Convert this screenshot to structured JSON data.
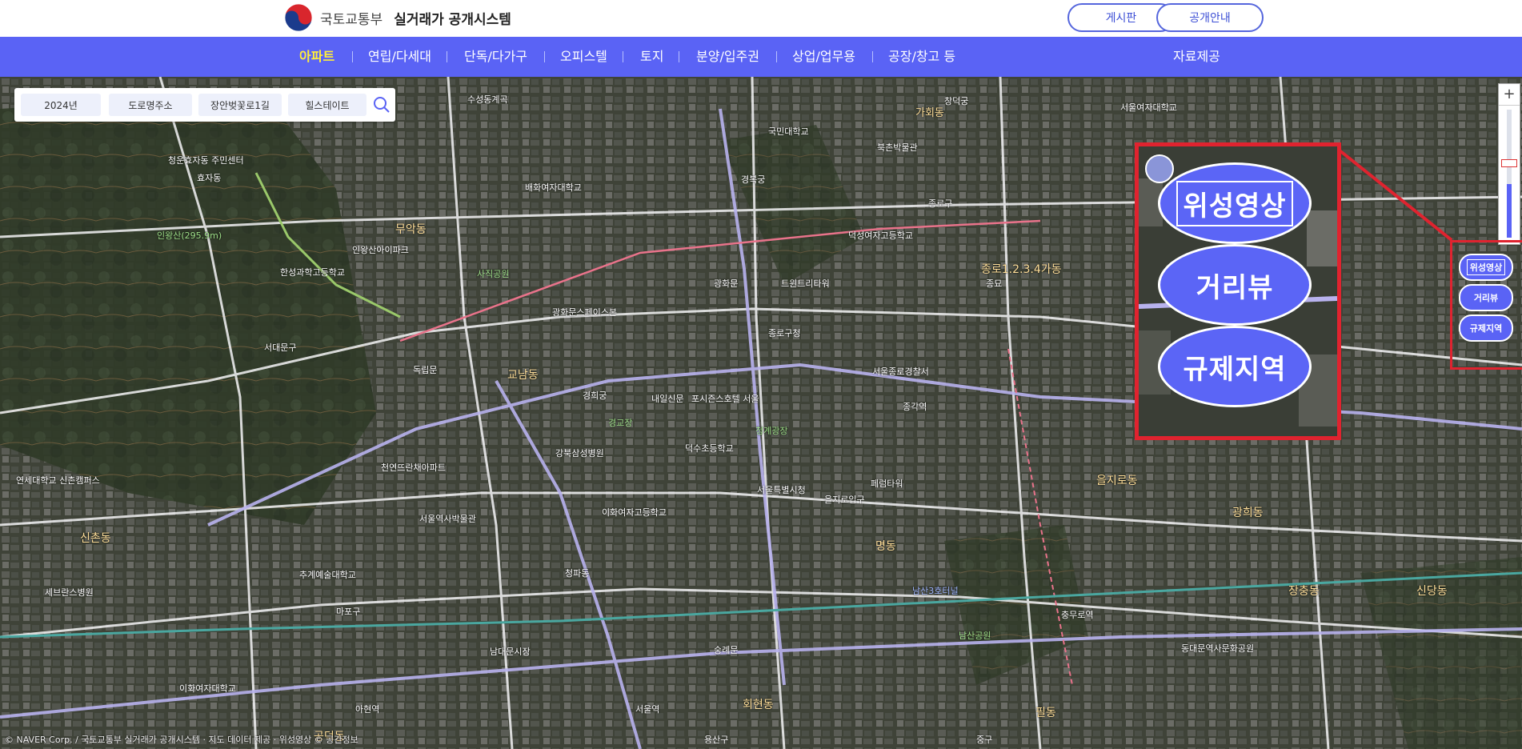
{
  "header": {
    "ministry": "국토교통부",
    "system_name": "실거래가 공개시스템",
    "board_label": "게시판",
    "guide_label": "공개안내"
  },
  "nav": {
    "items": [
      {
        "label": "아파트",
        "active": true
      },
      {
        "label": "연립/다세대"
      },
      {
        "label": "단독/다가구"
      },
      {
        "label": "오피스텔"
      },
      {
        "label": "토지"
      },
      {
        "label": "분양/입주권"
      },
      {
        "label": "상업/업무용"
      },
      {
        "label": "공장/창고 등"
      }
    ],
    "data_provision": "자료제공"
  },
  "search": {
    "year": "2024년",
    "address_type": "도로명주소",
    "road": "장안벚꽃로1길",
    "complex": "힐스테이트"
  },
  "map_controls": {
    "satellite": "위성영상",
    "street_view": "거리뷰",
    "regulation": "규제지역",
    "zoom_in": "+",
    "zoom_out": "−",
    "zoom_level": 0.42
  },
  "map_labels": [
    {
      "text": "청운효자동 주민센터"
    },
    {
      "text": "효자동"
    },
    {
      "text": "가회동"
    },
    {
      "text": "국민대학교"
    },
    {
      "text": "창덕궁"
    },
    {
      "text": "서울여자대학교"
    },
    {
      "text": "수성동계곡"
    },
    {
      "text": "배화여자대학교"
    },
    {
      "text": "경복궁"
    },
    {
      "text": "북촌박물관"
    },
    {
      "text": "덕성여자고등학교"
    },
    {
      "text": "무악동"
    },
    {
      "text": "인왕산(295.9m)"
    },
    {
      "text": "인왕산아이파크"
    },
    {
      "text": "한성과학고등학교"
    },
    {
      "text": "사직공원"
    },
    {
      "text": "광화문"
    },
    {
      "text": "트윈트리타워"
    },
    {
      "text": "종로1.2.3.4가동"
    },
    {
      "text": "광화문스페이스본"
    },
    {
      "text": "교남동"
    },
    {
      "text": "종로구청"
    },
    {
      "text": "종묘"
    },
    {
      "text": "독립문"
    },
    {
      "text": "경희궁"
    },
    {
      "text": "내일신문"
    },
    {
      "text": "포시즌스호텔 서울"
    },
    {
      "text": "서울종로경찰서"
    },
    {
      "text": "경교장"
    },
    {
      "text": "종각역"
    },
    {
      "text": "청계광장"
    },
    {
      "text": "덕수초등학교"
    },
    {
      "text": "강북삼성병원"
    },
    {
      "text": "천연뜨란채아파트"
    },
    {
      "text": "서울특별시청"
    },
    {
      "text": "을지로입구"
    },
    {
      "text": "을지로동"
    },
    {
      "text": "페럼타워"
    },
    {
      "text": "광희동"
    },
    {
      "text": "이화여자고등학교"
    },
    {
      "text": "신촌동"
    },
    {
      "text": "명동"
    },
    {
      "text": "남산3호터널"
    },
    {
      "text": "충무로역"
    },
    {
      "text": "회현동"
    },
    {
      "text": "서울역"
    },
    {
      "text": "남대문시장"
    },
    {
      "text": "세브란스병원"
    },
    {
      "text": "연세대학교 신촌캠퍼스"
    },
    {
      "text": "이화여자대학교"
    },
    {
      "text": "추계예술대학교"
    },
    {
      "text": "아현역"
    },
    {
      "text": "공덕동"
    },
    {
      "text": "청파동"
    },
    {
      "text": "서울역사박물관"
    },
    {
      "text": "동대문역사문화공원"
    },
    {
      "text": "필동"
    },
    {
      "text": "장충동"
    },
    {
      "text": "신당동"
    },
    {
      "text": "숭례문"
    },
    {
      "text": "남산공원"
    },
    {
      "text": "용산구"
    },
    {
      "text": "마포구"
    },
    {
      "text": "중구"
    },
    {
      "text": "종로구"
    },
    {
      "text": "서대문구"
    }
  ],
  "copyright": "© NAVER Corp. / 국토교통부 실거래가 공개시스템 · 지도 데이터 제공 · 위성영상 © 공간정보"
}
